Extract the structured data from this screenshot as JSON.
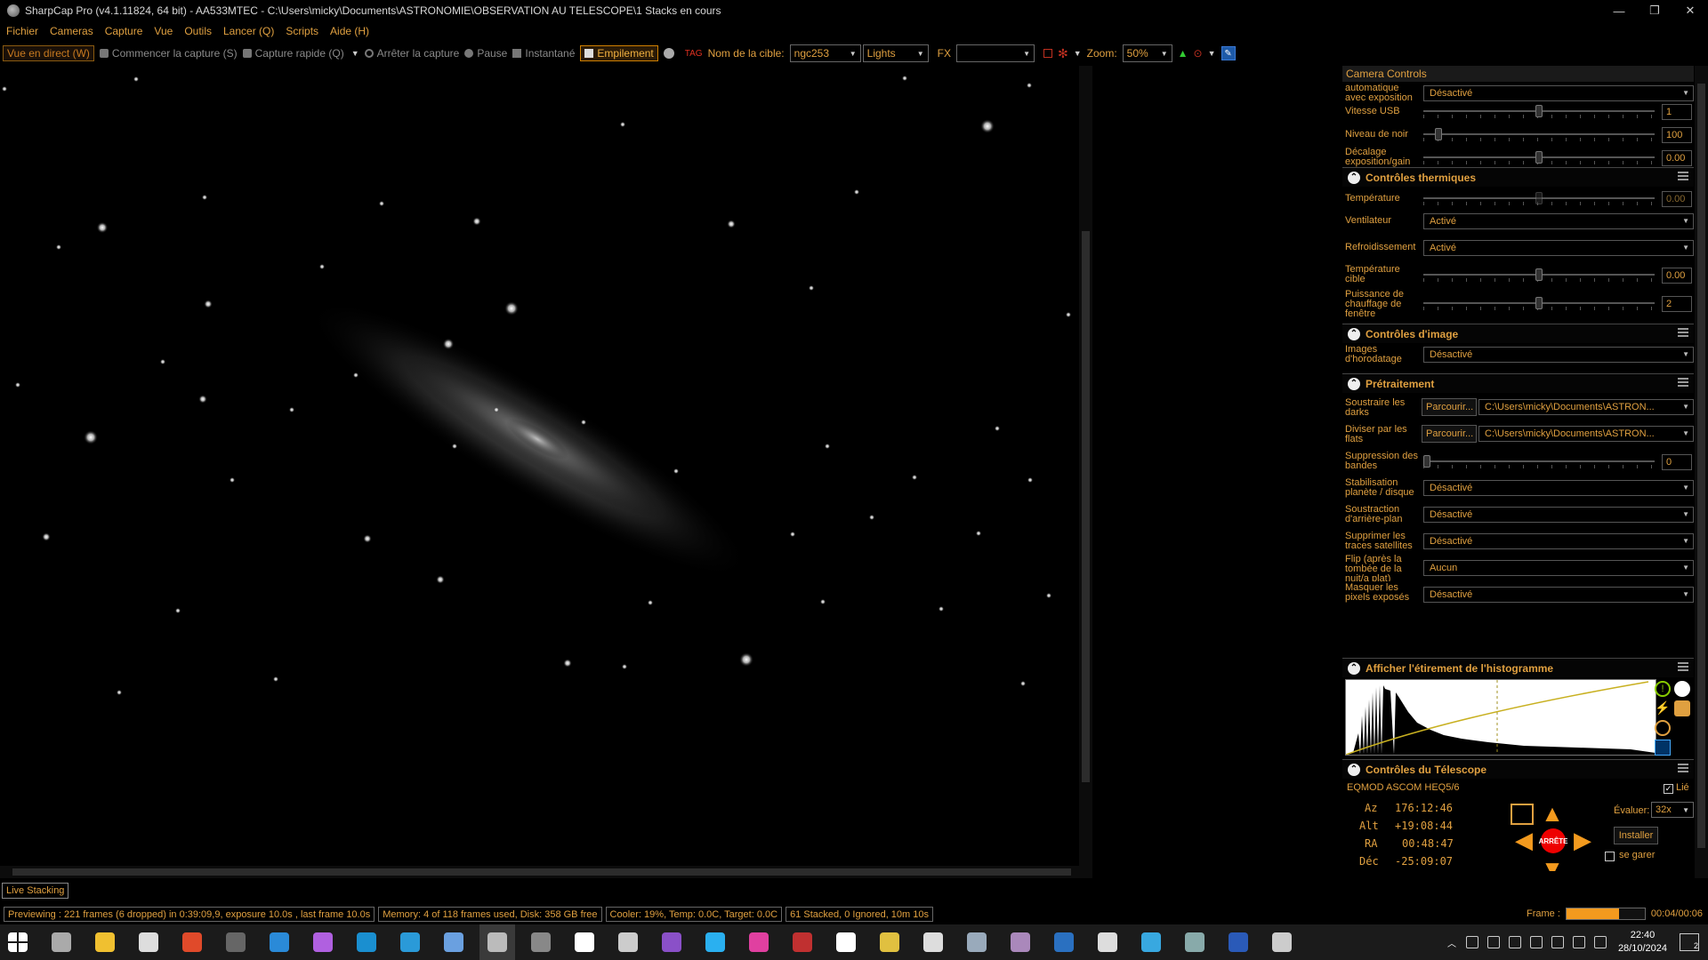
{
  "window": {
    "title": "SharpCap Pro (v4.1.11824, 64 bit) - AA533MTEC - C:\\Users\\micky\\Documents\\ASTRONOMIE\\OBSERVATION AU TELESCOPE\\1 Stacks en cours",
    "controls": [
      "—",
      "❐",
      "✕"
    ]
  },
  "menu": [
    "Fichier",
    "Cameras",
    "Capture",
    "Vue",
    "Outils",
    "Lancer (Q)",
    "Scripts",
    "Aide (H)"
  ],
  "toolbar": {
    "live_view": "Vue en direct (W)",
    "start_capture": "Commencer la capture (S)",
    "quick_capture": "Capture rapide (Q)",
    "stop_capture": "Arrêter la capture",
    "pause": "Pause",
    "snapshot": "Instantané",
    "stacking": "Empilement",
    "target_label": "Nom de la cible:",
    "target_value": "ngc253",
    "frame_type": "Lights",
    "fx_label": "FX",
    "fx_value": "",
    "zoom_label": "Zoom:",
    "zoom_value": "50%"
  },
  "panel": {
    "header": "Camera Controls",
    "camera_rows": [
      {
        "label": "automatique avec exposition",
        "value": "Désactivé"
      },
      {
        "label": "Vitesse USB",
        "number": "1",
        "level": 0.5
      },
      {
        "label": "Niveau de noir",
        "number": "100",
        "level": 0.05
      },
      {
        "label": "Décalage exposition/gain",
        "number": "0.00",
        "level": 0.5
      }
    ],
    "thermal": {
      "title": "Contrôles thermiques",
      "temperature_label": "Température",
      "temperature_value": "0.00",
      "fan_label": "Ventilateur",
      "fan_value": "Activé",
      "cooling_label": "Refroidissement",
      "cooling_value": "Activé",
      "target_temp_label": "Température cible",
      "target_temp_value": "0.00",
      "heater_label": "Puissance de chauffage de fenêtre",
      "heater_value": "2"
    },
    "image": {
      "title": "Contrôles d'image",
      "timestamp_label": "Images d'horodatage",
      "timestamp_value": "Désactivé"
    },
    "preprocess": {
      "title": "Prétraitement",
      "darks_label": "Soustraire les darks",
      "darks_button": "Parcourir...",
      "darks_path": "C:\\Users\\micky\\Documents\\ASTRON...",
      "flats_label": "Diviser par les flats",
      "flats_button": "Parcourir...",
      "flats_path": "C:\\Users\\micky\\Documents\\ASTRON...",
      "banding_label": "Suppression des bandes",
      "banding_value": "0",
      "stab_label": "Stabilisation planète / disque",
      "stab_value": "Désactivé",
      "bg_label": "Soustraction d'arrière-plan",
      "bg_value": "Désactivé",
      "sat_label": "Supprimer les traces satellites",
      "sat_value": "Désactivé",
      "flip_label": "Flip (après la tombée de la nuit/a plat)",
      "flip_value": "Aucun",
      "mask_label": "Masquer les pixels exposés",
      "mask_value": "Désactivé"
    },
    "histogram": {
      "title": "Afficher l'étirement de l'histogramme"
    },
    "telescope": {
      "title": "Contrôles du Télescope",
      "mount": "EQMOD ASCOM HEQ5/6",
      "linked_label": "Lié",
      "az_label": "Az",
      "az_value": "176:12:46",
      "alt_label": "Alt",
      "alt_value": "+19:08:44",
      "ra_label": "RA",
      "ra_value": "00:48:47",
      "dec_label": "Déc",
      "dec_value": "-25:09:07",
      "rate_label": "Évaluer:",
      "rate_value": "32x",
      "install": "Installer",
      "park_label": "se garer",
      "stop": "ARRÊTE"
    }
  },
  "status": {
    "live_stacking": "Live Stacking",
    "preview": "Previewing : 221 frames (6 dropped) in 0:39:09,9, exposure 10.0s , last frame 10.0s",
    "memory": "Memory: 4 of 118 frames used, Disk: 358 GB free",
    "cooler": "Cooler: 19%, Temp: 0.0C, Target: 0.0C",
    "stacked": "61 Stacked, 0 Ignored, 10m 10s",
    "frame_label": "Frame :",
    "frame_value": "00:04/00:06",
    "frame_progress": 0.67
  },
  "taskbar": {
    "time": "22:40",
    "date": "28/10/2024",
    "notif_count": "2",
    "apps": [
      "start-icon",
      "task-view-icon",
      "file-explorer-icon",
      "settings-icon",
      "app-icon",
      "notion-icon",
      "mail-icon",
      "messenger-icon",
      "edge-icon",
      "chat-icon",
      "vpn-icon",
      "sharpcap-icon",
      "app-icon",
      "app-icon",
      "app-icon",
      "app-icon",
      "app-icon",
      "app-icon",
      "app-icon",
      "app-icon",
      "app-icon",
      "app-icon",
      "app-icon",
      "app-icon",
      "app-icon",
      "app-icon",
      "app-icon",
      "app-icon",
      "app-icon",
      "app-icon"
    ]
  }
}
